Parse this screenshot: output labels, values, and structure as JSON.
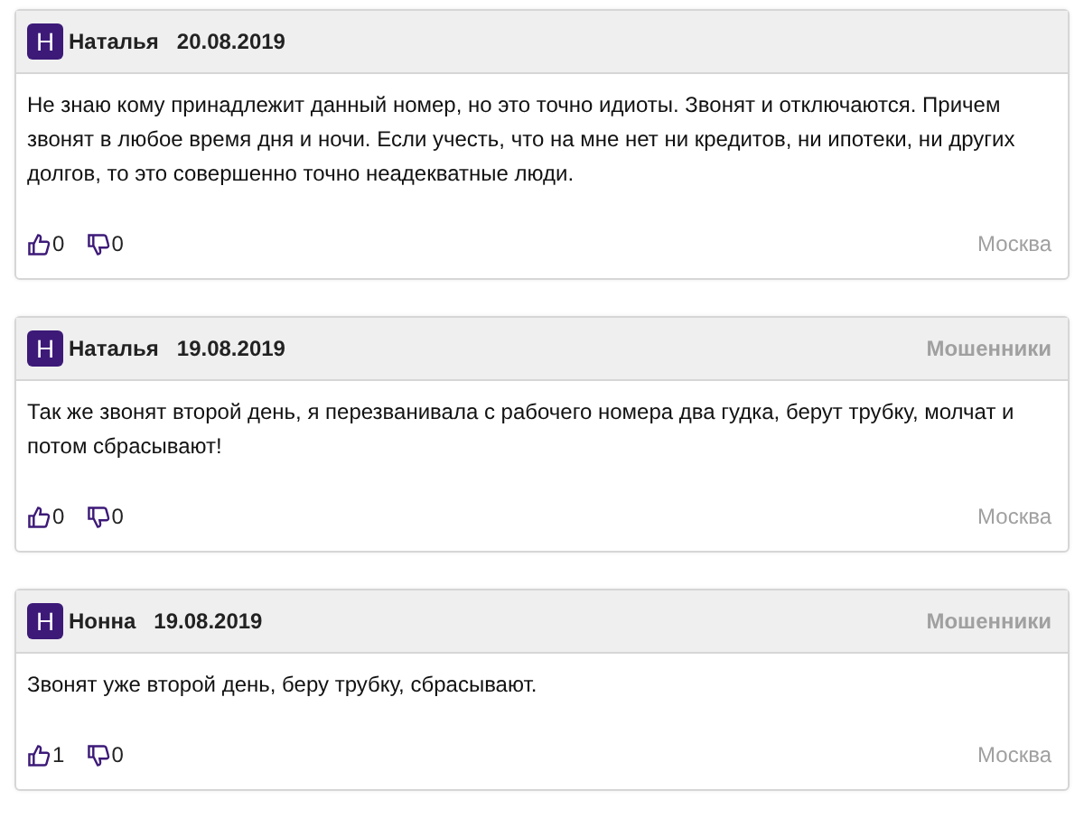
{
  "reviews": [
    {
      "avatar": "Н",
      "author": "Наталья",
      "date": "20.08.2019",
      "text": "Не знаю кому принадлежит данный номер, но это точно идиоты. Звонят и отключаются. Причем звонят в любое время дня и ночи. Если учесть, что на мне нет ни кредитов, ни ипотеки, ни других долгов, то это совершенно точно неадекватные люди.",
      "likes": "0",
      "dislikes": "0",
      "city": "Москва"
    },
    {
      "avatar": "Н",
      "author": "Наталья",
      "date": "19.08.2019",
      "category": "Мошенники",
      "text": "Так же звонят второй день, я перезванивала с рабочего номера два гудка, берут трубку, молчат и потом сбрасывают!",
      "likes": "0",
      "dislikes": "0",
      "city": "Москва"
    },
    {
      "avatar": "Н",
      "author": "Нонна",
      "date": "19.08.2019",
      "category": "Мошенники",
      "text": "Звонят уже второй день, беру трубку, сбрасывают.",
      "likes": "1",
      "dislikes": "0",
      "city": "Москва"
    }
  ]
}
